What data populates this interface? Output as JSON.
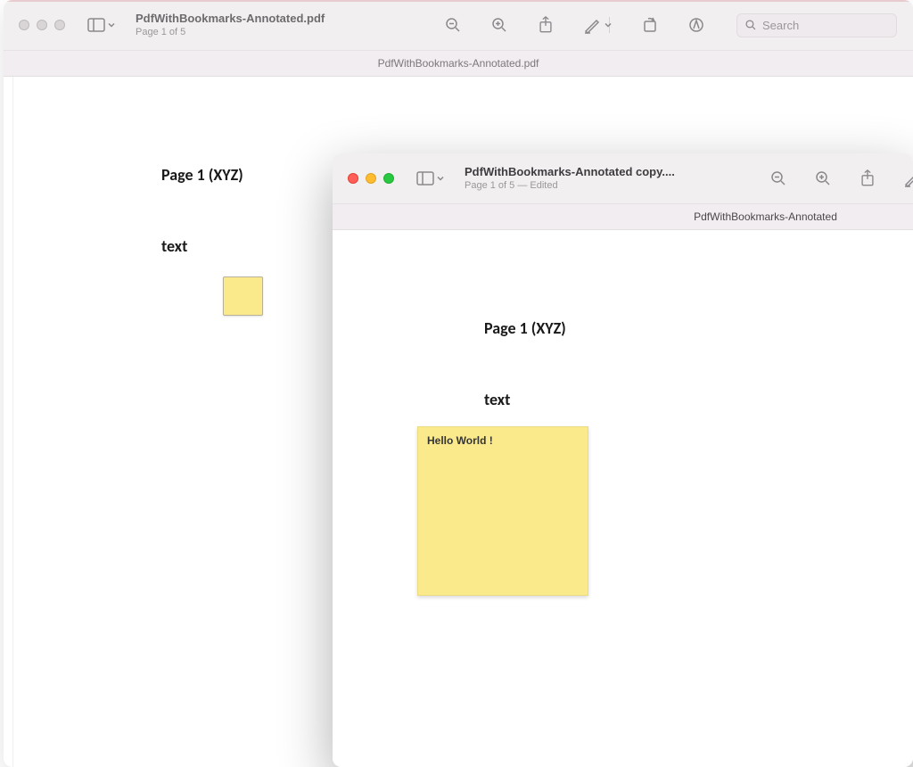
{
  "bg": {
    "title": "PdfWithBookmarks-Annotated.pdf",
    "subtitle": "Page 1 of 5",
    "tab": "PdfWithBookmarks-Annotated.pdf",
    "search_placeholder": "Search",
    "page_heading": "Page 1 (XYZ)",
    "page_text": "text"
  },
  "fg": {
    "title": "PdfWithBookmarks-Annotated copy....",
    "subtitle": "Page 1 of 5 — Edited",
    "tab": "PdfWithBookmarks-Annotated",
    "page_heading": "Page 1 (XYZ)",
    "page_text": "text",
    "note_text": "Hello World !"
  }
}
